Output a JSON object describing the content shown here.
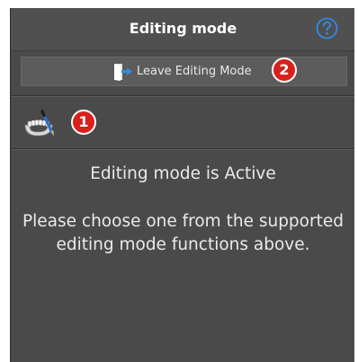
{
  "header": {
    "title": "Editing mode",
    "help_icon": "question-circle-icon",
    "help_color": "#2f8be6"
  },
  "toolbar": {
    "leave_label": "Leave Editing Mode",
    "leave_icon": "exit-door-icon",
    "callout_2": "2"
  },
  "tools": {
    "items": [
      {
        "icon": "dental-arch-edit-icon"
      }
    ],
    "callout_1": "1"
  },
  "content": {
    "status": "Editing mode is Active",
    "message": "Please choose one from the supported editing mode functions above."
  },
  "colors": {
    "panel_bg": "#4a4a4a",
    "callout_red": "#d8201c",
    "text": "#eaeaea"
  }
}
